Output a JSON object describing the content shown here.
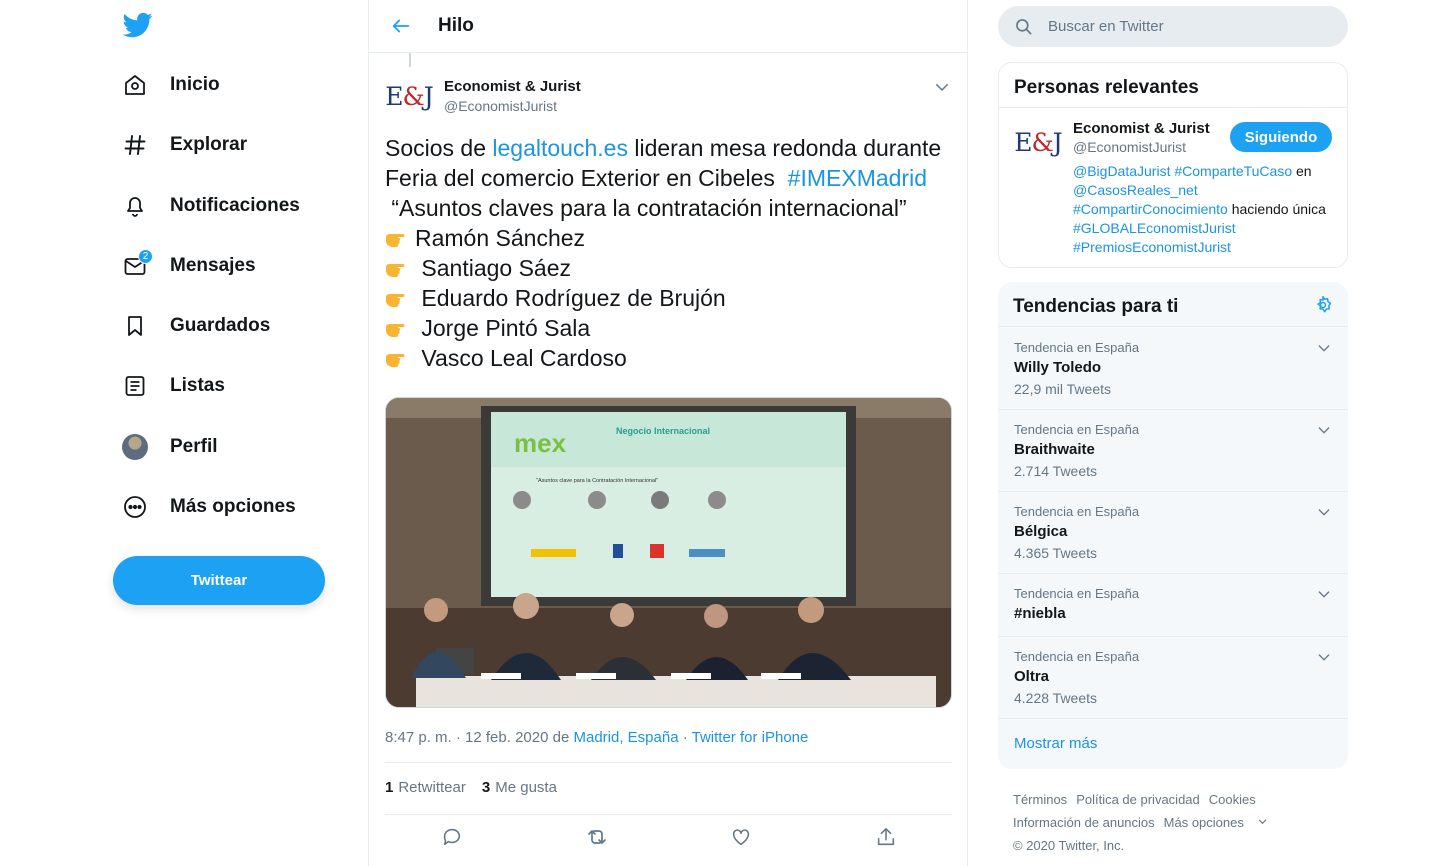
{
  "colors": {
    "accent": "#1da1f2",
    "link": "#1b95e0",
    "text": "#14171a",
    "muted": "#657786"
  },
  "nav": {
    "items": [
      {
        "label": "Inicio",
        "icon": "home-icon"
      },
      {
        "label": "Explorar",
        "icon": "hashtag-icon"
      },
      {
        "label": "Notificaciones",
        "icon": "bell-icon"
      },
      {
        "label": "Mensajes",
        "icon": "mail-icon",
        "badge": "2"
      },
      {
        "label": "Guardados",
        "icon": "bookmark-icon"
      },
      {
        "label": "Listas",
        "icon": "list-icon"
      },
      {
        "label": "Perfil",
        "icon": "avatar"
      },
      {
        "label": "Más opciones",
        "icon": "more-icon"
      }
    ],
    "tweet_button": "Twittear"
  },
  "header": {
    "title": "Hilo"
  },
  "tweet": {
    "author_name": "Economist & Jurist",
    "author_handle": "@EconomistJurist",
    "text": {
      "l1_pre": "Socios de ",
      "l1_link": "legaltouch.es",
      "l1_post": " lideran mesa redonda durante",
      "l2_pre": "Feria del comercio Exterior en Cibeles  ",
      "l2_tag": "#IMEXMadrid",
      "l3": " “Asuntos claves para la contratación internacional”",
      "names": [
        "Ramón Sánchez",
        " Santiago Sáez",
        " Eduardo Rodríguez de Brujón",
        " Jorge Pintó Sala",
        " Vasco Leal Cardoso"
      ]
    },
    "photo": {
      "slide_title": "Negocio Internacional",
      "slide_subtitle": "\"Asuntos clave para la Contratación Internacional\"",
      "slide_logo": "mex"
    },
    "time": "8:47 p. m. · 12 feb. 2020",
    "de": "de",
    "location": "Madrid, España",
    "source_sep": "·",
    "source": "Twitter for iPhone",
    "retweets_count": "1",
    "retweets_label": "Retwittear",
    "likes_count": "3",
    "likes_label": "Me gusta"
  },
  "search": {
    "placeholder": "Buscar en Twitter"
  },
  "people": {
    "title": "Personas relevantes",
    "name": "Economist & Jurist",
    "handle": "@EconomistJurist",
    "follow_label": "Siguiendo",
    "bio": {
      "t1": "@BigDataJurist",
      "t2": "#ComparteTuCaso",
      "w1": " en ",
      "t3": "@CasosReales_net",
      "t4": "#CompartirConocimiento",
      "w2": " haciendo única ",
      "t5": "#GLOBALEconomistJurist",
      "t6": "#PremiosEconomistJurist"
    }
  },
  "trends": {
    "title": "Tendencias para ti",
    "items": [
      {
        "context": "Tendencia en España",
        "name": "Willy Toledo",
        "count": "22,9 mil Tweets"
      },
      {
        "context": "Tendencia en España",
        "name": "Braithwaite",
        "count": "2.714 Tweets"
      },
      {
        "context": "Tendencia en España",
        "name": "Bélgica",
        "count": "4.365 Tweets"
      },
      {
        "context": "Tendencia en España",
        "name": "#niebla",
        "count": ""
      },
      {
        "context": "Tendencia en España",
        "name": "Oltra",
        "count": "4.228 Tweets"
      }
    ],
    "show_more": "Mostrar más"
  },
  "footer": {
    "terms": "Términos",
    "privacy": "Política de privacidad",
    "cookies": "Cookies",
    "ads": "Información de anuncios",
    "more": "Más opciones",
    "copyright": "© 2020 Twitter, Inc."
  }
}
